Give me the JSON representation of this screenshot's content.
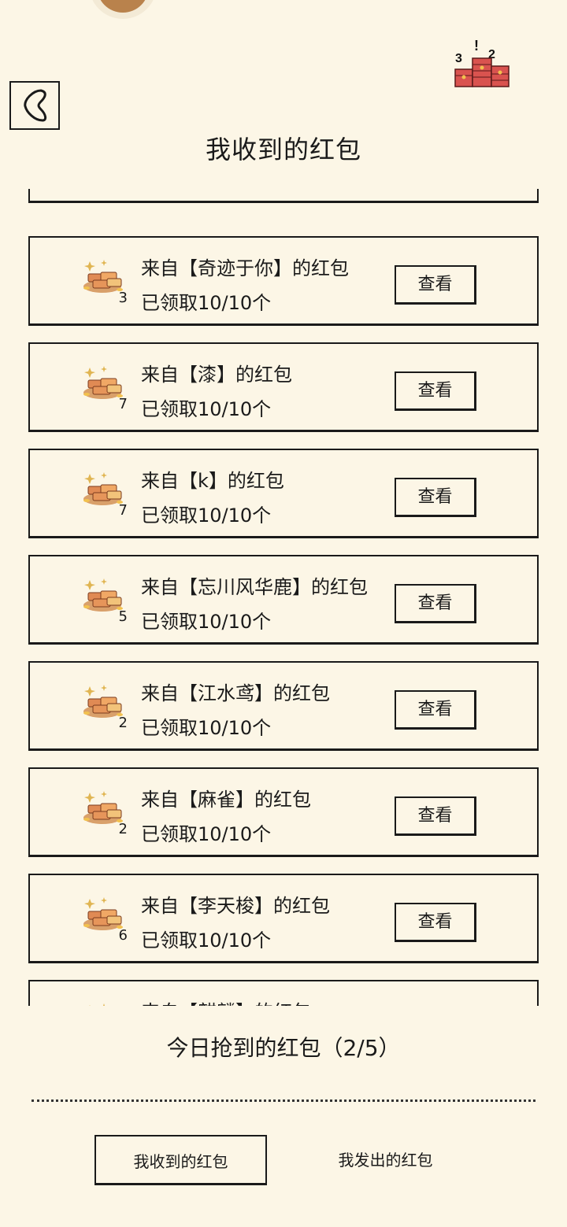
{
  "header": {
    "title": "我收到的红包",
    "rank_icon_digits": [
      "3",
      "!",
      "2"
    ]
  },
  "cards": [
    {
      "number": "3",
      "from_label": "来自【奇迹于你】的红包",
      "status": "已领取10/10个",
      "button_label": "查看"
    },
    {
      "number": "7",
      "from_label": "来自【漆】的红包",
      "status": "已领取10/10个",
      "button_label": "查看"
    },
    {
      "number": "7",
      "from_label": "来自【k】的红包",
      "status": "已领取10/10个",
      "button_label": "查看"
    },
    {
      "number": "5",
      "from_label": "来自【忘川风华鹿】的红包",
      "status": "已领取10/10个",
      "button_label": "查看"
    },
    {
      "number": "2",
      "from_label": "来自【江水鸢】的红包",
      "status": "已领取10/10个",
      "button_label": "查看"
    },
    {
      "number": "2",
      "from_label": "来自【麻雀】的红包",
      "status": "已领取10/10个",
      "button_label": "查看"
    },
    {
      "number": "6",
      "from_label": "来自【李天梭】的红包",
      "status": "已领取10/10个",
      "button_label": "查看"
    },
    {
      "number": "",
      "from_label": "来自【麒麟】的红包",
      "status": "",
      "button_label": ""
    }
  ],
  "footer": {
    "today_label": "今日抢到的红包（2/5）",
    "tabs": [
      {
        "label": "我收到的红包",
        "active": true
      },
      {
        "label": "我发出的红包",
        "active": false
      }
    ]
  }
}
